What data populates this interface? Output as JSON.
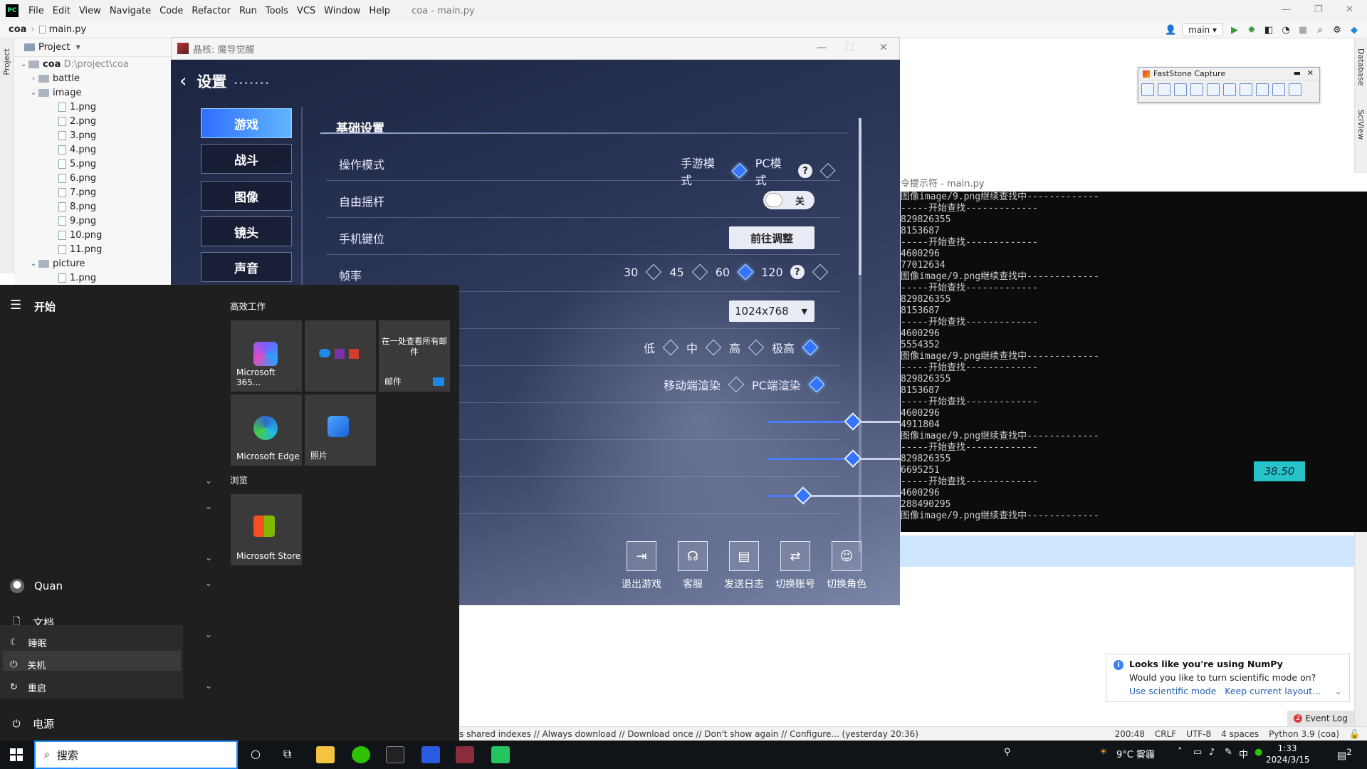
{
  "ide": {
    "menu": [
      "File",
      "Edit",
      "View",
      "Navigate",
      "Code",
      "Refactor",
      "Run",
      "Tools",
      "VCS",
      "Window",
      "Help"
    ],
    "window_title": "coa - main.py",
    "breadcrumb": [
      "coa",
      "main.py"
    ],
    "branch": "main",
    "project_label": "Project",
    "tree": {
      "root": "coa",
      "root_path": "D:\\project\\coa",
      "folders": [
        "battle",
        "image",
        "picture"
      ],
      "image_files": [
        "1.png",
        "2.png",
        "3.png",
        "4.png",
        "5.png",
        "6.png",
        "7.png",
        "8.png",
        "9.png",
        "10.png",
        "11.png"
      ],
      "picture_files": [
        "1.png"
      ]
    },
    "side_tabs": {
      "left": "Project",
      "right_top": "Database",
      "right_bottom": "SciView"
    },
    "status": {
      "message": "s shared indexes // Always download // Download once // Don't show again // Configure... (yesterday 20:36)",
      "position": "200:48",
      "line_ending": "CRLF",
      "encoding": "UTF-8",
      "indent": "4 spaces",
      "interpreter": "Python 3.9 (coa)"
    },
    "event_log": "Event Log",
    "event_count": "2",
    "notification": {
      "title": "Looks like you're using NumPy",
      "body": "Would you like to turn scientific mode on?",
      "link1": "Use scientific mode",
      "link2": "Keep current layout..."
    }
  },
  "faststone": {
    "title": "FastStone Capture"
  },
  "cmd": {
    "title": "令提示符 - main.py",
    "lines": [
      "图像image/9.png继续查找中-------------",
      "-----开始查找-------------",
      "829826355",
      "8153687",
      "-----开始查找-------------",
      "4600296",
      "77012634",
      "图像image/9.png继续查找中-------------",
      "-----开始查找-------------",
      "829826355",
      "8153687",
      "-----开始查找-------------",
      "4600296",
      "5554352",
      "图像image/9.png继续查找中-------------",
      "-----开始查找-------------",
      "829826355",
      "8153687",
      "-----开始查找-------------",
      "4600296",
      "4911804",
      "图像image/9.png继续查找中-------------",
      "-----开始查找-------------",
      "829826355",
      "6695251",
      "-----开始查找-------------",
      "4600296",
      "288490295",
      "图像image/9.png继续查找中-------------"
    ],
    "timer": "38.50"
  },
  "game": {
    "window_title": "晶核: 魔导觉醒",
    "header": "设置",
    "tabs": [
      "游戏",
      "战斗",
      "图像",
      "镜头",
      "声音"
    ],
    "active_tab": 0,
    "section": "基础设置",
    "rows": {
      "mode_label": "操作模式",
      "mode_opts": [
        "手游模式",
        "PC模式"
      ],
      "joystick_label": "自由摇杆",
      "joystick_state": "关",
      "keys_label": "手机键位",
      "keys_button": "前往调整",
      "fps_label": "帧率",
      "fps_opts": [
        "30",
        "45",
        "60",
        "120"
      ],
      "resolution": "1024x768",
      "quality_opts": [
        "低",
        "中",
        "高",
        "极高"
      ],
      "render_opts": [
        "移动端渲染",
        "PC端渲染"
      ]
    },
    "slider_values": [
      50,
      50,
      21
    ],
    "footer": [
      "退出游戏",
      "客服",
      "发送日志",
      "切换账号",
      "切换角色"
    ]
  },
  "start": {
    "title": "开始",
    "user": "Quan",
    "docs": "文档",
    "power_menu": [
      "睡眠",
      "关机",
      "重启"
    ],
    "power": "电源",
    "group1": "高效工作",
    "group2": "浏览",
    "tiles": {
      "m365": "Microsoft 365...",
      "mail_top": "在一处查看所有邮件",
      "mail": "邮件",
      "edge": "Microsoft Edge",
      "photos": "照片",
      "store": "Microsoft Store"
    }
  },
  "taskbar": {
    "search": "搜索",
    "weather": "9°C 雾霾",
    "ime": "中",
    "time": "1:33",
    "date": "2024/3/15",
    "notifications": "2"
  }
}
